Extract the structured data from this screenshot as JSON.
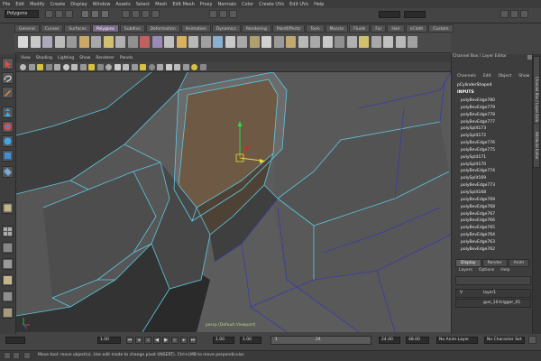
{
  "menubar": [
    "File",
    "Edit",
    "Modify",
    "Create",
    "Display",
    "Window",
    "Assets",
    "Select",
    "Mesh",
    "Edit Mesh",
    "Proxy",
    "Normals",
    "Color",
    "Create UVs",
    "Edit UVs",
    "Help"
  ],
  "status": {
    "mode": "Polygons"
  },
  "shelf": {
    "tabs": [
      "General",
      "Curves",
      "Surfaces",
      "Polygons",
      "Subdivs",
      "Deformation",
      "Animation",
      "Dynamics",
      "Rendering",
      "PaintEffects",
      "Toon",
      "Muscle",
      "Fluids",
      "Fur",
      "Hair",
      "nCloth",
      "Custom"
    ],
    "active": "Polygons"
  },
  "panel": {
    "menus": [
      "View",
      "Shading",
      "Lighting",
      "Show",
      "Renderer",
      "Panels"
    ],
    "camera": "persp (Default Viewport)"
  },
  "channelbox": {
    "title": "Channel Box / Layer Editor",
    "tabs": [
      "Channels",
      "Edit",
      "Object",
      "Show"
    ],
    "shape": "pCylinderShape4",
    "inputs_label": "INPUTS",
    "items": [
      "polyBevEdge780",
      "polyBevEdge779",
      "polyBevEdge778",
      "polyBevEdge777",
      "polySplit173",
      "polySplit172",
      "polyBevEdge776",
      "polyBevEdge775",
      "polySplit171",
      "polySplit170",
      "polyBevEdge774",
      "polySplit169",
      "polyBevEdge773",
      "polySplit168",
      "polyBevEdge769",
      "polyBevEdge768",
      "polyBevEdge767",
      "polyBevEdge766",
      "polyBevEdge765",
      "polyBevEdge764",
      "polyBevEdge763",
      "polyBevEdge762"
    ],
    "side_tabs": [
      "Channel Box / Layer Editor",
      "Attribute Editor"
    ]
  },
  "layers": {
    "tabs": [
      "Display",
      "Render",
      "Anim"
    ],
    "active": "Display",
    "menu": [
      "Layers",
      "Options",
      "Help"
    ],
    "rows": [
      {
        "visible": "V",
        "name": "layer1"
      },
      {
        "visible": "",
        "name": "gun_10:trigger_01"
      }
    ]
  },
  "range": {
    "start": "1.00",
    "current_a": "1.00",
    "current_b": "1.00",
    "range_start": "1",
    "range_end": "24",
    "end": "24.00",
    "max": "48.00",
    "anim_layer": "No Anim Layer",
    "char_set": "No Character Set"
  },
  "help": {
    "text": "Move tool: move object(s). Use edit mode to change pivot (INSERT). Ctrl+LMB to move perpendicular."
  },
  "colors": {
    "wire": "#5ec8e0",
    "selected_face": "#6e5a44",
    "bg": "#5e5e5e"
  }
}
